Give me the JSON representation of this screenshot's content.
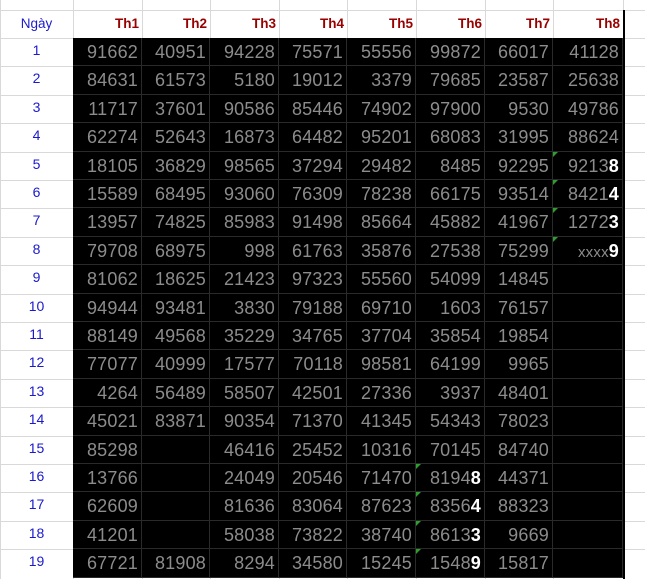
{
  "headers": [
    "Ngày",
    "Th1",
    "Th2",
    "Th3",
    "Th4",
    "Th5",
    "Th6",
    "Th7",
    "Th8"
  ],
  "rows": [
    {
      "day": "1",
      "values": [
        "91662",
        "40951",
        "94228",
        "75571",
        "55556",
        "99872",
        "66017",
        "41128"
      ]
    },
    {
      "day": "2",
      "values": [
        "84631",
        "61573",
        "5180",
        "19012",
        "3379",
        "79685",
        "23587",
        "25638"
      ]
    },
    {
      "day": "3",
      "values": [
        "11717",
        "37601",
        "90586",
        "85446",
        "74902",
        "97900",
        "9530",
        "49786"
      ]
    },
    {
      "day": "4",
      "values": [
        "62274",
        "52643",
        "16873",
        "64482",
        "95201",
        "68083",
        "31995",
        "88624"
      ]
    },
    {
      "day": "5",
      "values": [
        "18105",
        "36829",
        "98565",
        "37294",
        "29482",
        "8485",
        "92295",
        "92138"
      ]
    },
    {
      "day": "6",
      "values": [
        "15589",
        "68495",
        "93060",
        "76309",
        "78238",
        "66175",
        "93514",
        "84214"
      ]
    },
    {
      "day": "7",
      "values": [
        "13957",
        "74825",
        "85983",
        "91498",
        "85664",
        "45882",
        "41967",
        "12723"
      ]
    },
    {
      "day": "8",
      "values": [
        "79708",
        "68975",
        "998",
        "61763",
        "35876",
        "27538",
        "75299",
        "xxxx9"
      ]
    },
    {
      "day": "9",
      "values": [
        "81062",
        "18625",
        "21423",
        "97323",
        "55560",
        "54099",
        "14845",
        ""
      ]
    },
    {
      "day": "10",
      "values": [
        "94944",
        "93481",
        "3830",
        "79188",
        "69710",
        "1603",
        "76157",
        ""
      ]
    },
    {
      "day": "11",
      "values": [
        "88149",
        "49568",
        "35229",
        "34765",
        "37704",
        "35854",
        "19854",
        ""
      ]
    },
    {
      "day": "12",
      "values": [
        "77077",
        "40999",
        "17577",
        "70118",
        "98581",
        "64199",
        "9965",
        ""
      ]
    },
    {
      "day": "13",
      "values": [
        "4264",
        "56489",
        "58507",
        "42501",
        "27336",
        "3937",
        "48401",
        ""
      ]
    },
    {
      "day": "14",
      "values": [
        "45021",
        "83871",
        "90354",
        "71370",
        "41345",
        "54343",
        "78023",
        ""
      ]
    },
    {
      "day": "15",
      "values": [
        "85298",
        "",
        "46416",
        "25452",
        "10316",
        "70145",
        "84740",
        ""
      ]
    },
    {
      "day": "16",
      "values": [
        "13766",
        "",
        "24049",
        "20546",
        "71470",
        "81948",
        "44371",
        ""
      ]
    },
    {
      "day": "17",
      "values": [
        "62609",
        "",
        "81636",
        "83064",
        "87623",
        "83564",
        "88323",
        ""
      ]
    },
    {
      "day": "18",
      "values": [
        "41201",
        "",
        "58038",
        "73822",
        "38740",
        "86133",
        "9669",
        ""
      ]
    },
    {
      "day": "19",
      "values": [
        "67721",
        "81908",
        "8294",
        "34580",
        "15245",
        "15489",
        "15817",
        ""
      ]
    }
  ],
  "highlighted": [
    {
      "row": 4,
      "col": 7
    },
    {
      "row": 5,
      "col": 7
    },
    {
      "row": 6,
      "col": 7
    },
    {
      "row": 7,
      "col": 7
    },
    {
      "row": 15,
      "col": 5
    },
    {
      "row": 16,
      "col": 5
    },
    {
      "row": 17,
      "col": 5
    },
    {
      "row": 18,
      "col": 5
    }
  ],
  "colors": {
    "cell_bg": "#000000",
    "cell_text": "#8c8c8c",
    "highlight_text": "#ffffff",
    "day_text": "#1a1acc",
    "header_text": "#990000",
    "marker": "#2e9e2e"
  }
}
